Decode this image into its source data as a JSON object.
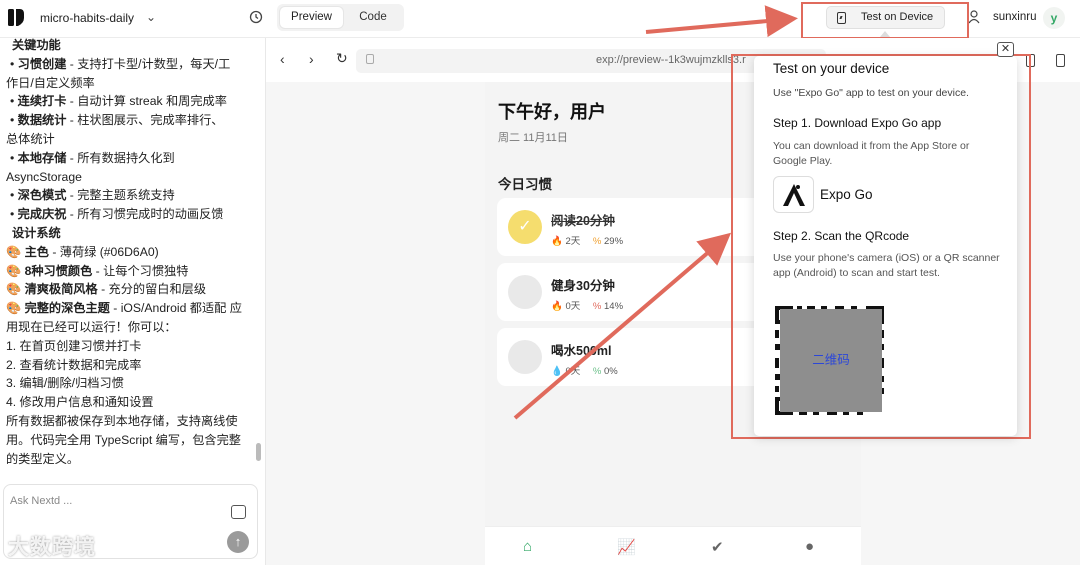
{
  "topbar": {
    "project_name": "micro-habits-daily",
    "tabs": {
      "preview": "Preview",
      "code": "Code"
    },
    "test_button": "Test on Device",
    "user_name": "sunxinru",
    "avatar_letter": "y"
  },
  "chat": {
    "lines": [
      {
        "prefix": "",
        "bold": "关键功能",
        "text": ""
      },
      {
        "prefix": "• ",
        "bold": "习惯创建",
        "text": " - 支持打卡型/计数型，每天/工"
      },
      {
        "prefix": "",
        "bold": "",
        "text": "作日/自定义频率"
      },
      {
        "prefix": "• ",
        "bold": "连续打卡",
        "text": " - 自动计算 streak 和周完成率"
      },
      {
        "prefix": "• ",
        "bold": "数据统计",
        "text": " - 柱状图展示、完成率排行、"
      },
      {
        "prefix": "",
        "bold": "",
        "text": "总体统计"
      },
      {
        "prefix": "• ",
        "bold": "本地存储",
        "text": " - 所有数据持久化到"
      },
      {
        "prefix": "",
        "bold": "",
        "text": "AsyncStorage"
      },
      {
        "prefix": "• ",
        "bold": "深色模式",
        "text": " - 完整主题系统支持"
      },
      {
        "prefix": "• ",
        "bold": "完成庆祝",
        "text": " - 所有习惯完成时的动画反馈"
      },
      {
        "prefix": "",
        "bold": "设计系统",
        "text": ""
      },
      {
        "prefix": "🎨 ",
        "bold": "主色",
        "text": " - 薄荷绿 (#06D6A0)"
      },
      {
        "prefix": "🎨 ",
        "bold": "8种习惯颜色",
        "text": " - 让每个习惯独特"
      },
      {
        "prefix": "🎨 ",
        "bold": "清爽极简风格",
        "text": " - 充分的留白和层级"
      },
      {
        "prefix": "🎨 ",
        "bold": "完整的深色主题",
        "text": " - iOS/Android 都适配 应"
      },
      {
        "prefix": "",
        "bold": "",
        "text": "用现在已经可以运行！你可以："
      },
      {
        "prefix": "",
        "bold": "",
        "text": "1. 在首页创建习惯并打卡"
      },
      {
        "prefix": "",
        "bold": "",
        "text": "2. 查看统计数据和完成率"
      },
      {
        "prefix": "",
        "bold": "",
        "text": "3. 编辑/删除/归档习惯"
      },
      {
        "prefix": "",
        "bold": "",
        "text": "4. 修改用户信息和通知设置"
      },
      {
        "prefix": "",
        "bold": "",
        "text": "所有数据都被保存到本地存储，支持离线使"
      },
      {
        "prefix": "",
        "bold": "",
        "text": "用。代码完全用 TypeScript 编写，包含完整"
      },
      {
        "prefix": "",
        "bold": "",
        "text": "的类型定义。"
      }
    ],
    "input_placeholder": "Ask Nextd ...",
    "watermark": "大数跨境"
  },
  "preview": {
    "url": "exp://preview--1k3wujmzklls3.r",
    "app": {
      "greeting": "下午好，用户",
      "date": "周二 11月11日",
      "section_title": "今日习惯",
      "habits": [
        {
          "name": "阅读20分钟",
          "streak": "2天",
          "rate": "29%",
          "done": true
        },
        {
          "name": "健身30分钟",
          "streak": "0天",
          "rate": "14%",
          "done": false
        },
        {
          "name": "喝水500ml",
          "streak": "0天",
          "rate": "0%",
          "done": false
        }
      ]
    }
  },
  "popup": {
    "title": "Test on your device",
    "subtitle": "Use \"Expo Go\" app to test on your device.",
    "step1_title": "Step 1. Download Expo Go app",
    "step1_desc": "You can download it from the App Store or Google Play.",
    "expo_name": "Expo Go",
    "step2_title": "Step 2. Scan the QRcode",
    "step2_desc": "Use your phone's camera (iOS) or a QR scanner app (Android) to scan and start test.",
    "qr_label": "二维码"
  },
  "colors": {
    "accent_red": "#e06a5c",
    "done_yellow": "#f5dd6e",
    "expo_green": "#33a866"
  }
}
